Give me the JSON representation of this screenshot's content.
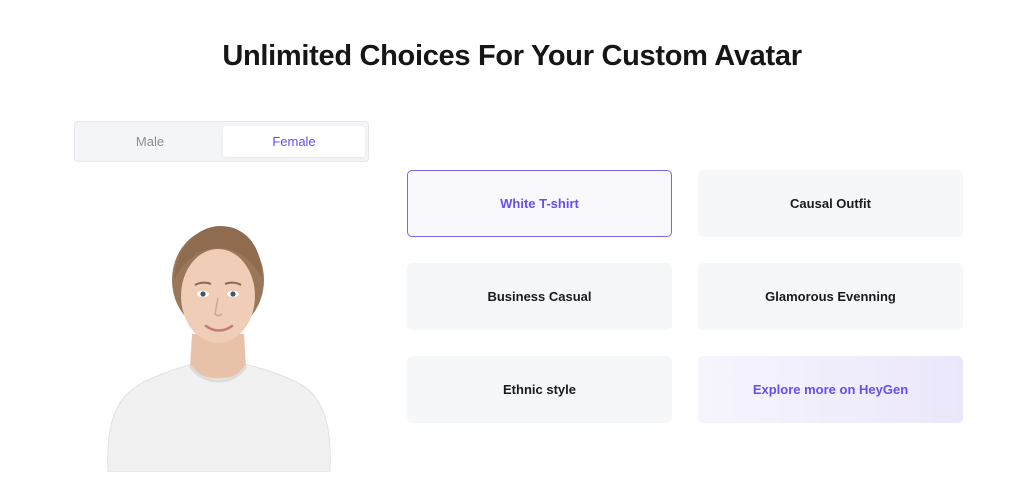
{
  "header": {
    "title": "Unlimited Choices For Your Custom Avatar"
  },
  "gender_toggle": {
    "options": [
      {
        "label": "Male",
        "selected": false
      },
      {
        "label": "Female",
        "selected": true
      }
    ]
  },
  "avatar": {
    "icon": "avatar-portrait-image",
    "description_visible": false
  },
  "outfits": [
    {
      "label": "White T-shirt",
      "selected": true
    },
    {
      "label": "Causal Outfit",
      "selected": false
    },
    {
      "label": "Business Casual",
      "selected": false
    },
    {
      "label": "Glamorous Evenning",
      "selected": false
    },
    {
      "label": "Ethnic style",
      "selected": false
    },
    {
      "label": "Explore more on HeyGen",
      "selected": false,
      "link": true
    }
  ],
  "colors": {
    "accent": "#6a4cf0",
    "selected_border": "#7a68ea",
    "card_bg": "#f6f7f9",
    "title": "#161616"
  }
}
